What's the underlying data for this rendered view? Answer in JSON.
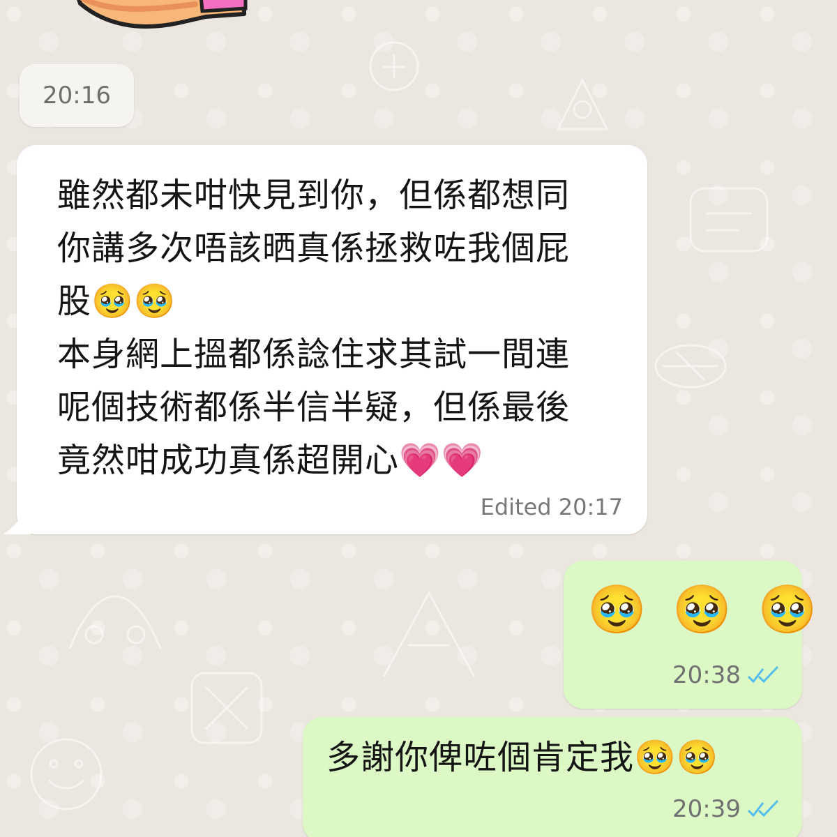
{
  "chat": {
    "date_chip": "20:16",
    "incoming": {
      "lines": [
        "雖然都未咁快見到你，但係都想同",
        "你講多次唔該晒真係拯救咗我個屁",
        "股🥹🥹",
        "本身網上搵都係諗住求其試一間連",
        "呢個技術都係半信半疑，但係最後",
        "竟然咁成功真係超開心💗💗"
      ],
      "status": "Edited 20:17"
    },
    "outgoing": [
      {
        "text": "🥹 🥹 🥹",
        "time": "20:38",
        "ticks_color": "#53bdeb"
      },
      {
        "text": "多謝你俾咗個肯定我🥹🥹",
        "time": "20:39",
        "ticks_color": "#53bdeb"
      }
    ]
  },
  "icons": {
    "read": "double-check-icon"
  },
  "colors": {
    "background": "#ebe6df",
    "incoming_bubble": "#ffffff",
    "outgoing_bubble": "#dbf8c5",
    "timestamp": "#777777"
  }
}
